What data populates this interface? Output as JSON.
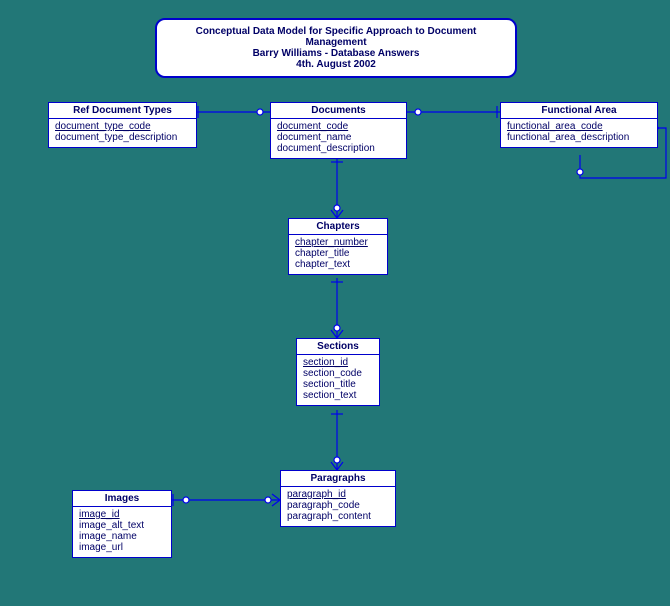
{
  "title": {
    "line1": "Conceptual Data Model for Specific Approach to Document Management",
    "line2": "Barry Williams - Database Answers",
    "line3": "4th. August 2002"
  },
  "entities": {
    "refdoc": {
      "name": "Ref Document Types",
      "pk": "document_type_code",
      "attrs": [
        "document_type_description"
      ]
    },
    "documents": {
      "name": "Documents",
      "pk": "document_code",
      "attrs": [
        "document_name",
        "document_description"
      ]
    },
    "funcarea": {
      "name": "Functional Area",
      "pk": "functional_area_code",
      "attrs": [
        "functional_area_description"
      ]
    },
    "chapters": {
      "name": "Chapters",
      "pk": "chapter_number",
      "attrs": [
        "chapter_title",
        "chapter_text"
      ]
    },
    "sections": {
      "name": "Sections",
      "pk": "section_id",
      "attrs": [
        "section_code",
        "section_title",
        "section_text"
      ]
    },
    "paragraphs": {
      "name": "Paragraphs",
      "pk": "paragraph_id",
      "attrs": [
        "paragraph_code",
        "paragraph_content"
      ]
    },
    "images": {
      "name": "Images",
      "pk": "image_id",
      "attrs": [
        "image_alt_text",
        "image_name",
        "image_url"
      ]
    }
  }
}
